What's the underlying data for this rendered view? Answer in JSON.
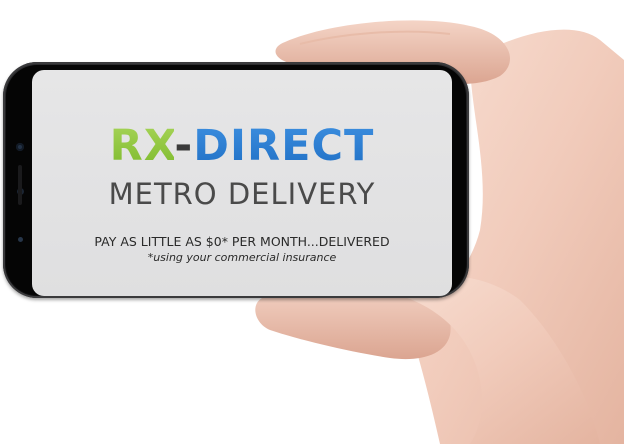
{
  "logo": {
    "rx": "RX",
    "dash": "-",
    "direct": "DIRECT",
    "rx_color": "#8cc63f",
    "direct_color": "#2b7fd4"
  },
  "subtitle": "METRO DELIVERY",
  "tagline": "PAY AS LITTLE AS $0* PER MONTH...DELIVERED",
  "note": "*using your commercial insurance",
  "colors": {
    "screen_background": "#e3e3e4",
    "phone_body": "#111112",
    "skin": "#f3d2c4"
  },
  "icons": {
    "front_camera": "camera-lens-icon",
    "sensor": "sensor-dot-icon"
  }
}
